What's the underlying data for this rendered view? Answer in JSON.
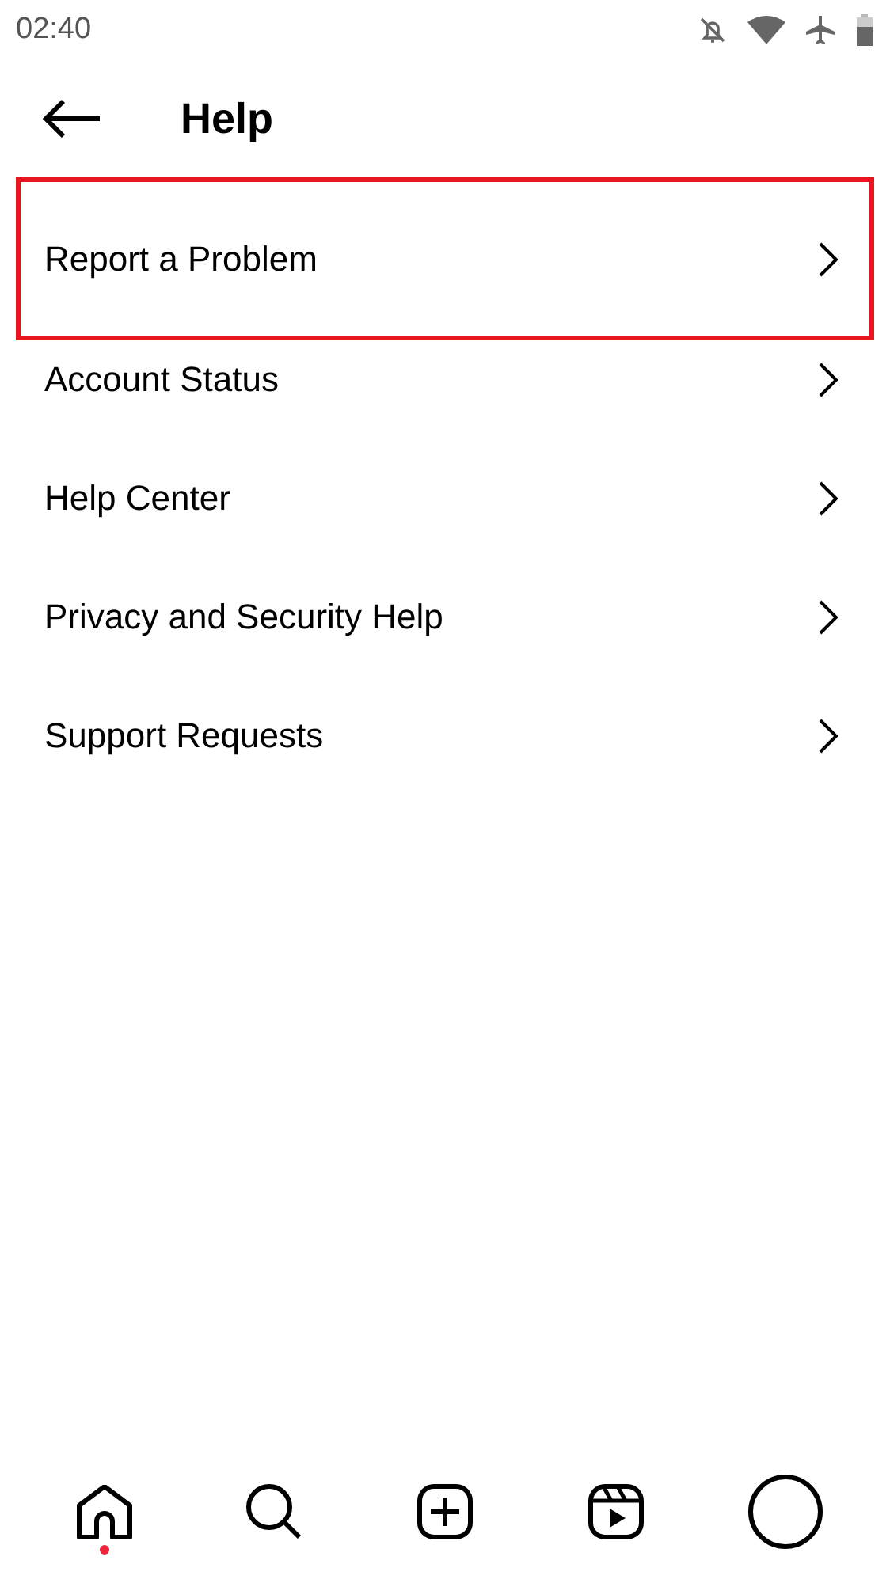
{
  "status_bar": {
    "time": "02:40"
  },
  "header": {
    "title": "Help"
  },
  "items": [
    {
      "label": "Report a Problem",
      "highlighted": true
    },
    {
      "label": "Account Status",
      "highlighted": false
    },
    {
      "label": "Help Center",
      "highlighted": false
    },
    {
      "label": "Privacy and Security Help",
      "highlighted": false
    },
    {
      "label": "Support Requests",
      "highlighted": false
    }
  ],
  "nav": [
    {
      "kind": "home",
      "dot": true
    },
    {
      "kind": "search",
      "dot": false
    },
    {
      "kind": "create",
      "dot": false
    },
    {
      "kind": "reels",
      "dot": false
    },
    {
      "kind": "profile",
      "dot": false
    }
  ]
}
